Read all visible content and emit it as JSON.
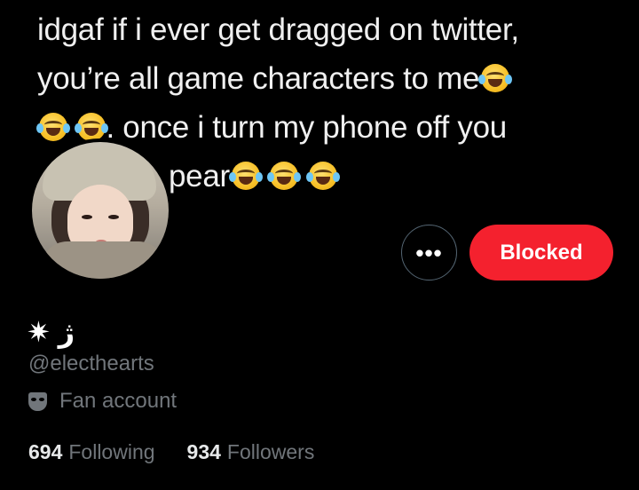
{
  "banner": {
    "line1": "idgaf if i ever get dragged on twitter,",
    "line2": "you’re all game characters to me",
    "line3": ". once i turn my phone off you",
    "line4": "pear"
  },
  "profile": {
    "display_name": "✷ ژ",
    "handle": "@electhearts",
    "label": "Fan account"
  },
  "actions": {
    "more": "•••",
    "blocked": "Blocked"
  },
  "stats": {
    "following_count": "694",
    "following_label": "Following",
    "followers_count": "934",
    "followers_label": "Followers"
  },
  "colors": {
    "blocked_bg": "#f4212e",
    "muted_text": "#71767b"
  },
  "icons": {
    "emoji": "face-with-tears-of-joy",
    "label_icon": "mask-icon",
    "more_icon": "ellipsis-icon"
  }
}
